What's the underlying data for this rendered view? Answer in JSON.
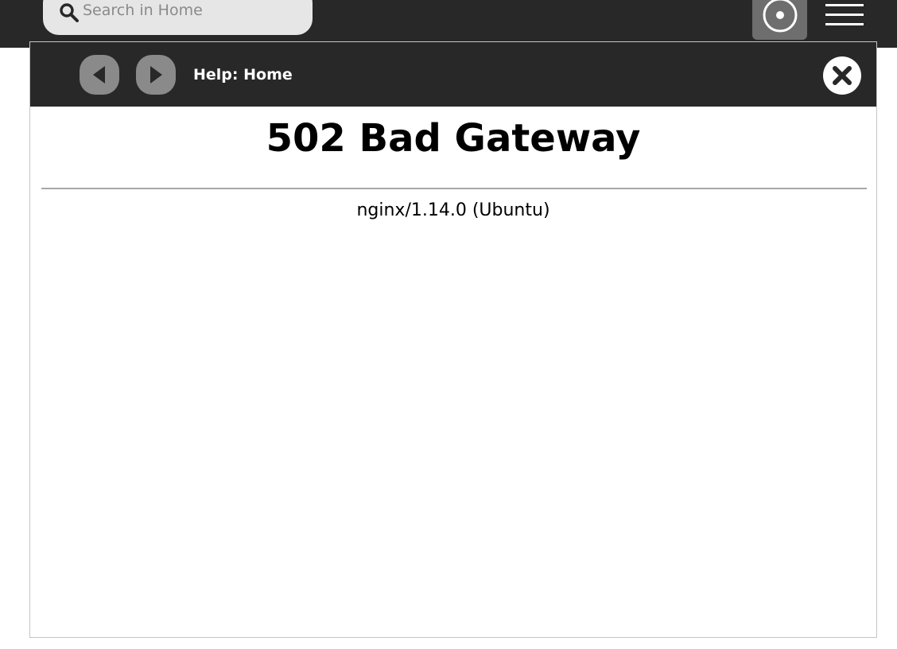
{
  "topbar": {
    "search": {
      "placeholder": "Search in Home",
      "icon": "search-icon"
    },
    "theme_button": {
      "icon": "record-icon"
    },
    "menu_button": {
      "icon": "hamburger-menu-icon"
    }
  },
  "dialog": {
    "title": "Help: Home",
    "back_icon": "triangle-left-icon",
    "forward_icon": "triangle-right-icon",
    "close_icon": "close-icon"
  },
  "page": {
    "heading": "502 Bad Gateway",
    "server": "nginx/1.14.0 (Ubuntu)"
  },
  "colors": {
    "bar_background": "#282828",
    "nav_button": "#8a8a8a",
    "search_background": "#e6e6e6",
    "divider": "#a8a8a8"
  }
}
